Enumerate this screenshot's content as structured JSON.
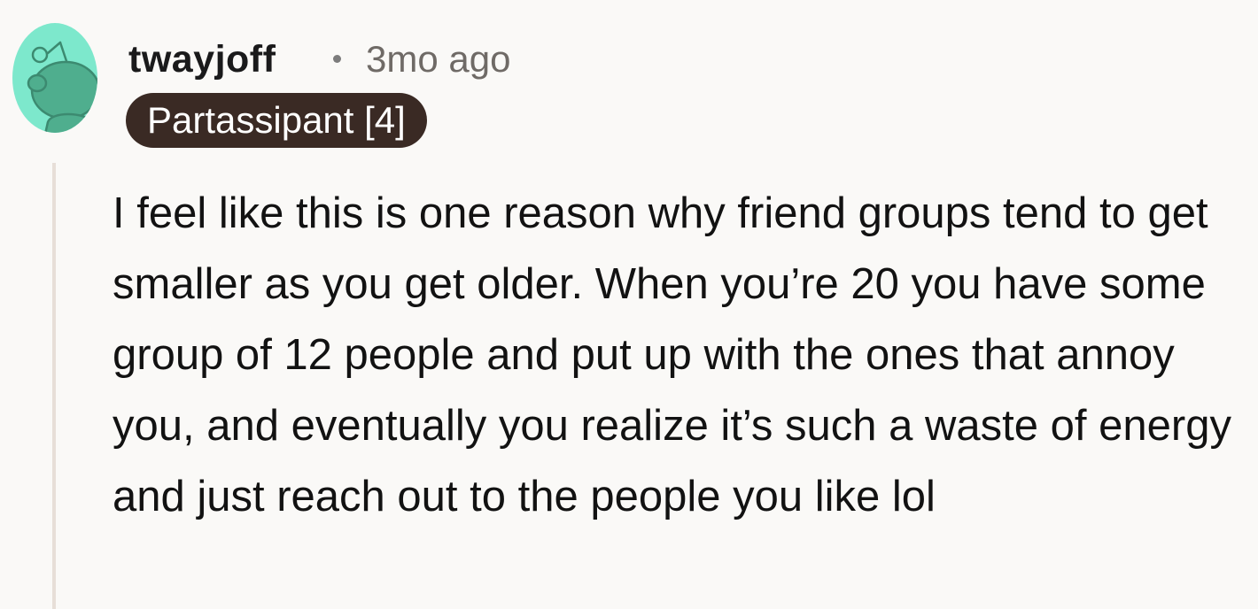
{
  "comment": {
    "author": "twayjoff",
    "timestamp": "3mo ago",
    "flair": "Partassipant [4]",
    "body": "I feel like this is one reason why friend groups tend to get smaller as you get older. When you’re 20 you have some group of 12 people and put up with the ones that annoy you, and eventually you realize it’s such a waste of energy and just reach out to the people you like lol",
    "avatar_icon": "snoo-avatar-icon",
    "colors": {
      "avatar_bg": "#7DE8CC",
      "avatar_figure": "#4FAE8E",
      "flair_bg": "#3A2A24",
      "flair_text": "#FFFFFF",
      "thread_line": "#E7DFD8",
      "background": "#FAF9F7"
    }
  }
}
